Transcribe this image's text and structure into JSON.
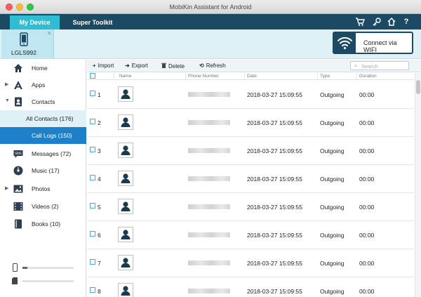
{
  "window": {
    "title": "MobiKin Assistant for Android"
  },
  "tabs": {
    "my_device": "My Device",
    "super_toolkit": "Super Toolkit"
  },
  "device": {
    "name": "LGLS992",
    "close_glyph": "✕"
  },
  "wifi": {
    "label": "Connect via WIFI"
  },
  "sidebar": {
    "items": [
      {
        "label": "Home",
        "icon": "home-icon"
      },
      {
        "label": "Apps",
        "icon": "apps-icon",
        "expandable": true
      },
      {
        "label": "Contacts",
        "icon": "contacts-icon",
        "expandable": true
      },
      {
        "label": "All Contacts (176)",
        "sub": true
      },
      {
        "label": "Call Logs (150)",
        "sub": true,
        "active": true
      },
      {
        "label": "Messages (72)",
        "icon": "sms-icon"
      },
      {
        "label": "Music (17)",
        "icon": "music-icon"
      },
      {
        "label": "Photos",
        "icon": "photos-icon",
        "expandable": true
      },
      {
        "label": "Videos (2)",
        "icon": "videos-icon"
      },
      {
        "label": "Books (10)",
        "icon": "books-icon"
      }
    ],
    "storage": {
      "internal_fraction": 0.1,
      "sd_fraction": 0.0
    }
  },
  "toolbar": {
    "import": "Import",
    "export": "Export",
    "delete": "Delete",
    "refresh": "Refresh"
  },
  "search": {
    "placeholder": "Search"
  },
  "table": {
    "columns": [
      "Name",
      "Phone Number",
      "Date",
      "Type",
      "Duration"
    ],
    "rows": [
      {
        "index": "1",
        "date": "2018-03-27 15:09:55",
        "type": "Outgoing",
        "duration": "00:00"
      },
      {
        "index": "2",
        "date": "2018-03-27 15:09:55",
        "type": "Outgoing",
        "duration": "00:00"
      },
      {
        "index": "3",
        "date": "2018-03-27 15:09:55",
        "type": "Outgoing",
        "duration": "00:00"
      },
      {
        "index": "4",
        "date": "2018-03-27 15:09:55",
        "type": "Outgoing",
        "duration": "00:00"
      },
      {
        "index": "5",
        "date": "2018-03-27 15:09:55",
        "type": "Outgoing",
        "duration": "00:00"
      },
      {
        "index": "6",
        "date": "2018-03-27 15:09:55",
        "type": "Outgoing",
        "duration": "00:00"
      },
      {
        "index": "7",
        "date": "2018-03-27 15:09:55",
        "type": "Outgoing",
        "duration": "00:00"
      },
      {
        "index": "8",
        "date": "2018-03-27 15:09:55",
        "type": "Outgoing",
        "duration": "00:00"
      }
    ]
  },
  "colors": {
    "topbar": "#1c4a63",
    "active_tab": "#2ebdd3",
    "active_nav": "#1e80c8",
    "device_bar": "#dff1f7"
  }
}
